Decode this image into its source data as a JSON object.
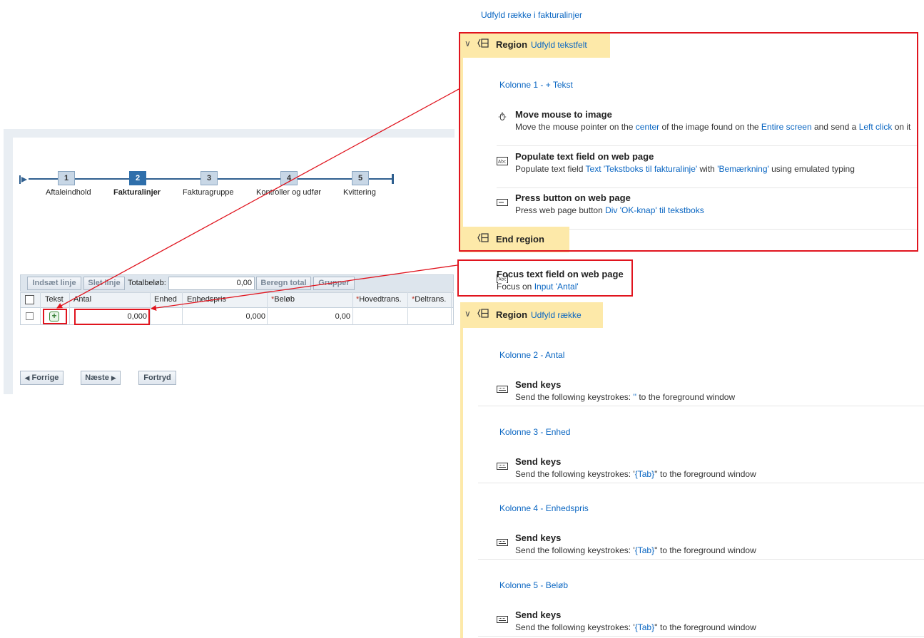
{
  "form": {
    "steps": [
      {
        "number": "1",
        "label": "Aftaleindhold"
      },
      {
        "number": "2",
        "label": "Fakturalinjer"
      },
      {
        "number": "3",
        "label": "Fakturagruppe"
      },
      {
        "number": "4",
        "label": "Kontroller og udfør"
      },
      {
        "number": "5",
        "label": "Kvittering"
      }
    ],
    "active_step": 2,
    "toolbar": {
      "insert_line": "Indsæt linje",
      "delete_line": "Slet linje",
      "total_label": "Totalbeløb:",
      "total_value": "0,00",
      "calc_total": "Beregn total",
      "group": "Grupper"
    },
    "grid": {
      "headers": {
        "text": "Tekst",
        "antal": "Antal",
        "enhed": "Enhed",
        "enhedspris": "Enhedspris",
        "belob": "Beløb",
        "hovedtrans": "Hovedtrans.",
        "deltrans": "Deltrans."
      },
      "required_mark": "*",
      "row": {
        "antal": "0,000",
        "enhedspris": "0,000",
        "belob": "0,00"
      }
    },
    "nav": {
      "previous": "Forrige",
      "next": "Næste",
      "cancel": "Fortryd"
    }
  },
  "flow": {
    "title": "Udfyld række i fakturalinjer",
    "region1": {
      "keyword": "Region",
      "label": "Udfyld tekstfelt",
      "comment": "Kolonne 1 - + Tekst",
      "actions": [
        {
          "title": "Move mouse to image",
          "desc": [
            "Move the mouse pointer on the ",
            "center",
            " of the image found on the ",
            "Entire screen",
            " and send a ",
            "Left click",
            " on it"
          ]
        },
        {
          "title": "Populate text field on web page",
          "desc": [
            "Populate text field ",
            "Text 'Tekstboks til fakturalinje'",
            " with ",
            "'Bemærkning'",
            " using emulated typing"
          ]
        },
        {
          "title": "Press button on web page",
          "desc": [
            "Press web page button ",
            "Div 'OK-knap' til tekstboks"
          ]
        }
      ],
      "end": "End region"
    },
    "focus_action": {
      "title": "Focus text field on web page",
      "desc": [
        "Focus on ",
        "Input 'Antal'"
      ]
    },
    "region2": {
      "keyword": "Region",
      "label": "Udfyld række",
      "blocks": [
        {
          "comment": "Kolonne 2 - Antal",
          "title": "Send keys",
          "desc": [
            "Send the following keystrokes: ",
            "''",
            " to the foreground window"
          ]
        },
        {
          "comment": "Kolonne 3 - Enhed",
          "title": "Send keys",
          "desc": [
            "Send the following keystrokes: '",
            "{Tab}",
            "'' to the foreground window"
          ]
        },
        {
          "comment": "Kolonne 4 - Enhedspris",
          "title": "Send keys",
          "desc": [
            "Send the following keystrokes: '",
            "{Tab}",
            "'' to the foreground window"
          ]
        },
        {
          "comment": "Kolonne 5 - Beløb",
          "title": "Send keys",
          "desc": [
            "Send the following keystrokes: '",
            "{Tab}",
            "'' to the foreground window"
          ]
        }
      ]
    }
  },
  "colors": {
    "highlight": "#e0141e",
    "region_fill": "#fde9a9",
    "link": "#0a66c2",
    "step_active": "#2f6fab"
  },
  "icons": [
    "collapse-chevron-icon",
    "region-icon",
    "mouse-icon",
    "textfield-icon",
    "button-icon",
    "focus-field-icon",
    "keyboard-icon",
    "plus-icon",
    "arrow-left-icon",
    "arrow-right-icon"
  ]
}
